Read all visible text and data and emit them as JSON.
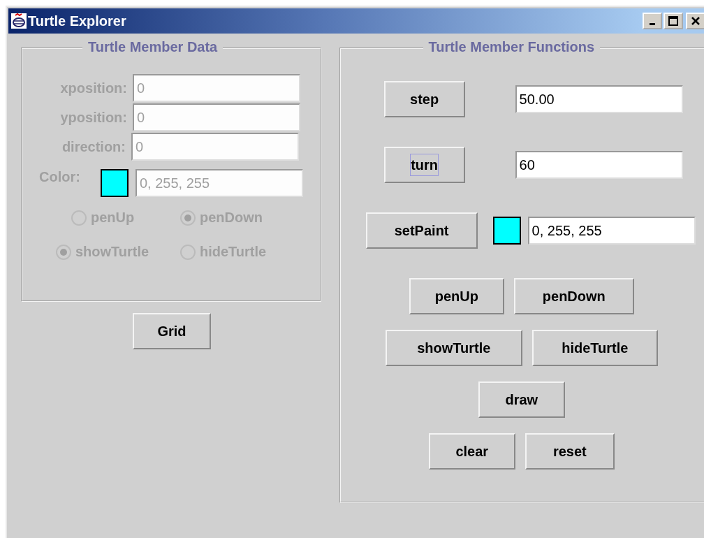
{
  "window": {
    "title": "Turtle Explorer"
  },
  "member_data": {
    "title": "Turtle Member Data",
    "disabled": true,
    "fields": [
      {
        "label": "xposition:",
        "value": "0"
      },
      {
        "label": "yposition:",
        "value": "0"
      },
      {
        "label": "direction:",
        "value": "0"
      }
    ],
    "color": {
      "label": "Color:",
      "color": "#00ffff",
      "value": "0, 255, 255"
    },
    "radio_groups": [
      [
        {
          "label": "penUp",
          "selected": false
        },
        {
          "label": "penDown",
          "selected": true
        }
      ],
      [
        {
          "label": "showTurtle",
          "selected": true
        },
        {
          "label": "hideTurtle",
          "selected": false
        }
      ]
    ]
  },
  "grid_button": "Grid",
  "member_functions": {
    "title": "Turtle Member Functions",
    "rows": [
      {
        "kind": "number",
        "button": "step",
        "value": "50.00",
        "focused": false
      },
      {
        "kind": "number",
        "button": "turn",
        "value": "60",
        "focused": true
      },
      {
        "kind": "color",
        "button": "setPaint",
        "color": "#00ffff",
        "value": "0, 255, 255"
      }
    ],
    "button_rows": [
      [
        "penUp",
        "penDown"
      ],
      [
        "showTurtle",
        "hideTurtle"
      ],
      [
        "draw"
      ],
      [
        "clear",
        "reset"
      ]
    ]
  }
}
